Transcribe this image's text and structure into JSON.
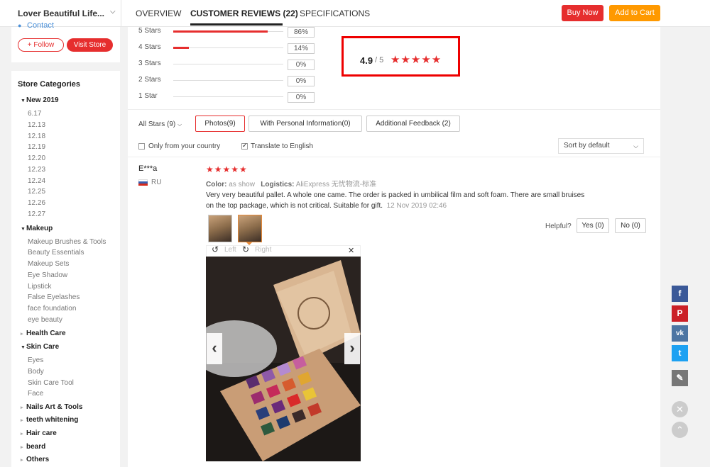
{
  "header": {
    "store_name": "Lover Beautiful Life...",
    "tabs": [
      "OVERVIEW",
      "CUSTOMER REVIEWS (22)",
      "SPECIFICATIONS"
    ],
    "buy_now": "Buy Now",
    "add_to_cart": "Add to Cart"
  },
  "store": {
    "contact": "Contact",
    "follow": "+ Follow",
    "visit": "Visit Store",
    "categories_title": "Store Categories",
    "categories": [
      {
        "name": "New 2019",
        "expanded": true,
        "children": [
          "6.17",
          "12.13",
          "12.18",
          "12.19",
          "12.20",
          "12.23",
          "12.24",
          "12.25",
          "12.26",
          "12.27"
        ]
      },
      {
        "name": "Makeup",
        "expanded": true,
        "children": [
          "Makeup Brushes & Tools",
          "Beauty Essentials",
          "Makeup Sets",
          "Eye Shadow",
          "Lipstick",
          "False Eyelashes",
          "face foundation",
          "eye beauty"
        ]
      },
      {
        "name": "Health Care",
        "expanded": false,
        "children": []
      },
      {
        "name": "Skin Care",
        "expanded": true,
        "children": [
          "Eyes",
          "Body",
          "Skin Care Tool",
          "Face"
        ]
      },
      {
        "name": "Nails Art & Tools",
        "expanded": false,
        "children": []
      },
      {
        "name": "teeth whitening",
        "expanded": false,
        "children": []
      },
      {
        "name": "Hair care",
        "expanded": false,
        "children": []
      },
      {
        "name": "beard",
        "expanded": false,
        "children": []
      },
      {
        "name": "Others",
        "expanded": false,
        "children": []
      }
    ]
  },
  "ratings": {
    "rows": [
      {
        "label": "5 Stars",
        "pct": "86%",
        "fraction": 0.86
      },
      {
        "label": "4 Stars",
        "pct": "14%",
        "fraction": 0.14
      },
      {
        "label": "3 Stars",
        "pct": "0%",
        "fraction": 0
      },
      {
        "label": "2 Stars",
        "pct": "0%",
        "fraction": 0
      },
      {
        "label": "1 Star",
        "pct": "0%",
        "fraction": 0
      }
    ],
    "score": "4.9",
    "score_denom": "/ 5",
    "stars": "★★★★★"
  },
  "filters": {
    "all_stars": "All Stars (9)",
    "photos": "Photos(9)",
    "personal": "With Personal Information(0)",
    "additional": "Additional Feedback (2)",
    "only_country": "Only from your country",
    "translate": "Translate to English",
    "translate_checked": true,
    "sort": "Sort by default"
  },
  "review": {
    "name": "E***a",
    "country": "RU",
    "stars": "★★★★★",
    "color_label": "Color:",
    "color_value": "as show",
    "logistics_label": "Logistics:",
    "logistics_value": "AliExpress 无忧物流-标准",
    "text": "Very very beautiful pallet. A whole one came. The order is packed in umbilical film and soft foam. There are small bruises on the top package, which is not critical. Suitable for gift.",
    "date": "12 Nov 2019 02:46",
    "helpful": "Helpful?",
    "yes": "Yes (0)",
    "no": "No (0)",
    "rotate_left": "Left",
    "rotate_right": "Right"
  },
  "share": {
    "facebook": "f",
    "pinterest": "P",
    "vk": "vk",
    "twitter": "t"
  },
  "colors": {
    "accent": "#e62e2e",
    "cart": "#ff9900",
    "facebook": "#3b5998",
    "pinterest": "#cb2027",
    "vk": "#4c75a3",
    "twitter": "#1da1f2"
  }
}
